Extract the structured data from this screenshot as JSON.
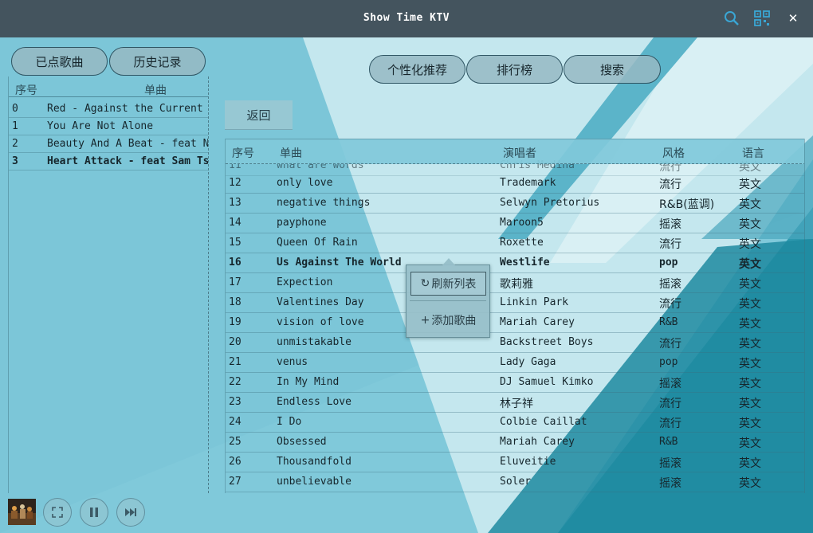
{
  "app": {
    "title": "Show Time KTV"
  },
  "titlebar": {
    "icons": [
      "search-icon",
      "qr-grid-icon",
      "close-icon"
    ],
    "close_glyph": "✕"
  },
  "left_tabs": {
    "requested": "已点歌曲",
    "history": "历史记录"
  },
  "top_tabs": {
    "recommend": "个性化推荐",
    "charts": "排行榜",
    "search": "搜索"
  },
  "queue": {
    "headers": {
      "index": "序号",
      "song": "单曲"
    },
    "rows": [
      {
        "index": "0",
        "song": "Red - Against the Current"
      },
      {
        "index": "1",
        "song": "You Are Not Alone"
      },
      {
        "index": "2",
        "song": "Beauty And A Beat - feat Ni"
      },
      {
        "index": "3",
        "song": "Heart Attack - feat Sam Tsui"
      }
    ]
  },
  "return_label": "返回",
  "songs": {
    "headers": {
      "index": "序号",
      "song": "单曲",
      "singer": "演唱者",
      "style": "风格",
      "language": "语言"
    },
    "partial_row": {
      "index": "11",
      "song": "what are words",
      "singer": "Chris Medina",
      "style": "流行",
      "language": "英文"
    },
    "rows": [
      {
        "index": "12",
        "song": "only love",
        "singer": "Trademark",
        "style": "流行",
        "language": "英文"
      },
      {
        "index": "13",
        "song": "negative things",
        "singer": "Selwyn Pretorius",
        "style": "R&B(蓝调)",
        "language": "英文"
      },
      {
        "index": "14",
        "song": "payphone",
        "singer": "Maroon5",
        "style": "摇滚",
        "language": "英文"
      },
      {
        "index": "15",
        "song": "Queen Of Rain",
        "singer": "Roxette",
        "style": "流行",
        "language": "英文"
      },
      {
        "index": "16",
        "song": "Us Against The World",
        "singer": "Westlife",
        "style": "pop",
        "language": "英文"
      },
      {
        "index": "17",
        "song": "Expection",
        "singer": "歌莉雅",
        "style": "摇滚",
        "language": "英文"
      },
      {
        "index": "18",
        "song": "Valentines Day",
        "singer": "Linkin Park",
        "style": "流行",
        "language": "英文"
      },
      {
        "index": "19",
        "song": "vision of love",
        "singer": "Mariah Carey",
        "style": "R&B",
        "language": "英文"
      },
      {
        "index": "20",
        "song": "unmistakable",
        "singer": "Backstreet Boys",
        "style": "流行",
        "language": "英文"
      },
      {
        "index": "21",
        "song": "venus",
        "singer": "Lady Gaga",
        "style": "pop",
        "language": "英文"
      },
      {
        "index": "22",
        "song": "In My Mind",
        "singer": "DJ Samuel Kimko",
        "style": "摇滚",
        "language": "英文"
      },
      {
        "index": "23",
        "song": "Endless Love",
        "singer": "林子祥",
        "style": "流行",
        "language": "英文"
      },
      {
        "index": "24",
        "song": "I Do",
        "singer": "Colbie Caillat",
        "style": "流行",
        "language": "英文"
      },
      {
        "index": "25",
        "song": "Obsessed",
        "singer": "Mariah Carey",
        "style": "R&B",
        "language": "英文"
      },
      {
        "index": "26",
        "song": "Thousandfold",
        "singer": "Eluveitie",
        "style": "摇滚",
        "language": "英文"
      },
      {
        "index": "27",
        "song": "unbelievable",
        "singer": "Soler",
        "style": "摇滚",
        "language": "英文"
      }
    ]
  },
  "context_menu": {
    "refresh": "刷新列表",
    "add": "添加歌曲",
    "refresh_glyph": "↻",
    "add_glyph": "+"
  },
  "player": {
    "icons": [
      "album-cover",
      "fullscreen-icon",
      "pause-icon",
      "next-icon"
    ]
  },
  "colors": {
    "titlebar": "#44545e",
    "background": "#7fcadb",
    "accent_dark": "#1e7f93"
  }
}
